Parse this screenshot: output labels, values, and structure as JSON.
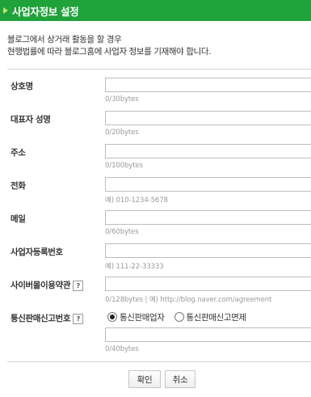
{
  "header": {
    "title": "사업자정보 설정"
  },
  "intro": {
    "line1": "블로그에서 상거래 활동을 할 경우",
    "line2": "현행법률에 따라 블로그홈에 사업자 정보를 기재해야 합니다."
  },
  "fields": {
    "company": {
      "label": "상호명",
      "value": "",
      "hint": "0/30bytes"
    },
    "rep": {
      "label": "대표자 성명",
      "value": "",
      "hint": "0/20bytes"
    },
    "address": {
      "label": "주소",
      "value": "",
      "hint": "0/100bytes"
    },
    "phone": {
      "label": "전화",
      "value": "",
      "hint": "예) 010-1234-5678"
    },
    "email": {
      "label": "메일",
      "value": "",
      "hint": "0/60bytes"
    },
    "bizno": {
      "label": "사업자등록번호",
      "value": "",
      "hint": "예) 111-22-33333"
    },
    "terms": {
      "label": "사이버몰이용약관",
      "value": "",
      "hint": "0/128bytes | 예) http://blog.naver.com/agreement"
    },
    "mailorder": {
      "label": "통신판매신고번호",
      "value": "",
      "hint": "0/40bytes",
      "options": [
        "통신판매업자",
        "통신판매신고면제"
      ],
      "selected": "통신판매업자"
    }
  },
  "help_glyph": "?",
  "buttons": {
    "confirm": "확인",
    "cancel": "취소"
  }
}
